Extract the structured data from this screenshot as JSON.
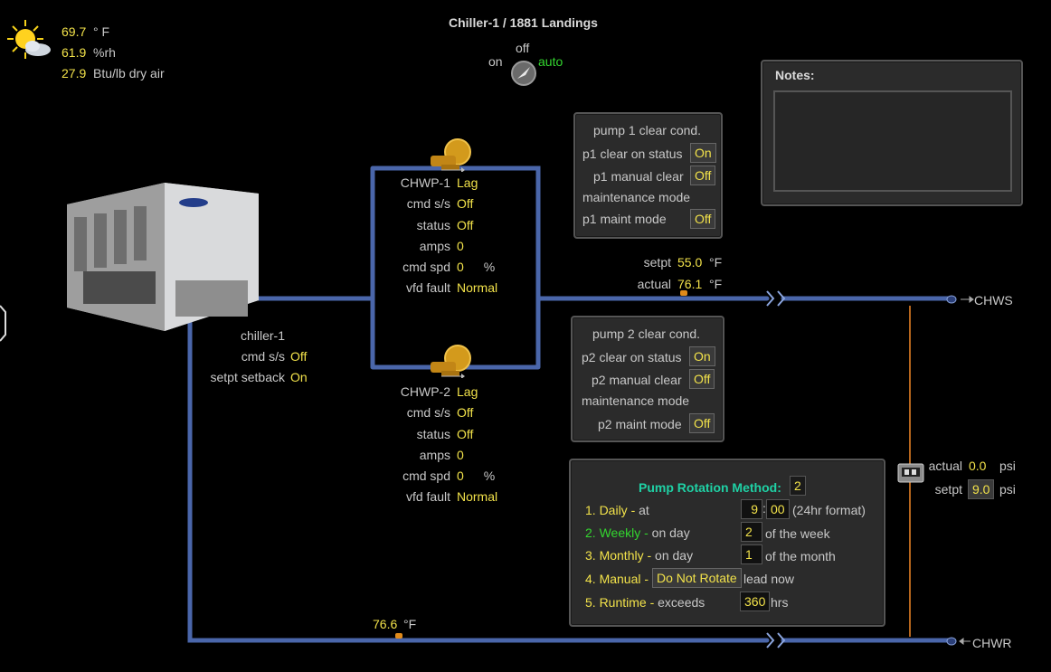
{
  "title": "Chiller-1 / 1881 Landings",
  "weather": {
    "icon": "sun-cloud-icon",
    "temp": "69.7",
    "temp_unit": "° F",
    "rh": "61.9",
    "rh_unit": "%rh",
    "enthalpy": "27.9",
    "enthalpy_unit": "Btu/lb dry air"
  },
  "mode_switch": {
    "off": "off",
    "on": "on",
    "auto": "auto"
  },
  "notes": {
    "label": "Notes:"
  },
  "chiller": {
    "name": "chiller-1",
    "cmd_label": "cmd s/s",
    "cmd": "Off",
    "setback_label": "setpt setback",
    "setback": "On"
  },
  "pump1": {
    "name": "CHWP-1",
    "role": "Lag",
    "cmd_label": "cmd s/s",
    "cmd": "Off",
    "status_label": "status",
    "status": "Off",
    "amps_label": "amps",
    "amps": "0",
    "spd_label": "cmd spd",
    "spd": "0",
    "spd_unit": "%",
    "vfd_label": "vfd fault",
    "vfd": "Normal"
  },
  "pump2": {
    "name": "CHWP-2",
    "role": "Lag",
    "cmd_label": "cmd s/s",
    "cmd": "Off",
    "status_label": "status",
    "status": "Off",
    "amps_label": "amps",
    "amps": "0",
    "spd_label": "cmd spd",
    "spd": "0",
    "spd_unit": "%",
    "vfd_label": "vfd fault",
    "vfd": "Normal"
  },
  "p1_panel": {
    "title": "pump 1 clear cond.",
    "clear_status_label": "p1 clear on status",
    "clear_status": "On",
    "manual_clear_label": "p1 manual clear",
    "manual_clear": "Off",
    "maint_header": "maintenance mode",
    "maint_label": "p1 maint mode",
    "maint": "Off"
  },
  "p2_panel": {
    "title": "pump 2 clear cond.",
    "clear_status_label": "p2 clear on status",
    "clear_status": "On",
    "manual_clear_label": "p2 manual clear",
    "manual_clear": "Off",
    "maint_header": "maintenance mode",
    "maint_label": "p2 maint mode",
    "maint": "Off"
  },
  "supply": {
    "setpt_label": "setpt",
    "setpt": "55.0",
    "setpt_unit": "°F",
    "actual_label": "actual",
    "actual": "76.1",
    "actual_unit": "°F",
    "tag": "CHWS"
  },
  "return": {
    "temp": "76.6",
    "unit": "°F",
    "tag": "CHWR"
  },
  "dp": {
    "actual_label": "actual",
    "actual": "0.0",
    "actual_unit": "psi",
    "setpt_label": "setpt",
    "setpt": "9.0",
    "setpt_unit": "psi"
  },
  "rotation": {
    "title": "Pump Rotation Method:",
    "method": "2",
    "daily_label": "1. Daily -",
    "daily_at": "at",
    "daily_hr": "9",
    "daily_min": "00",
    "daily_fmt": "(24hr format)",
    "weekly_label": "2. Weekly -",
    "weekly_on": "on day",
    "weekly_day": "2",
    "weekly_suffix": "of the week",
    "monthly_label": "3. Monthly -",
    "monthly_on": "on day",
    "monthly_day": "1",
    "monthly_suffix": "of the month",
    "manual_label": "4. Manual -",
    "manual_btn": "Do Not Rotate",
    "manual_suffix": "lead now",
    "runtime_label": "5. Runtime -",
    "runtime_exceeds": "exceeds",
    "runtime_hrs": "360",
    "runtime_unit": "hrs"
  }
}
